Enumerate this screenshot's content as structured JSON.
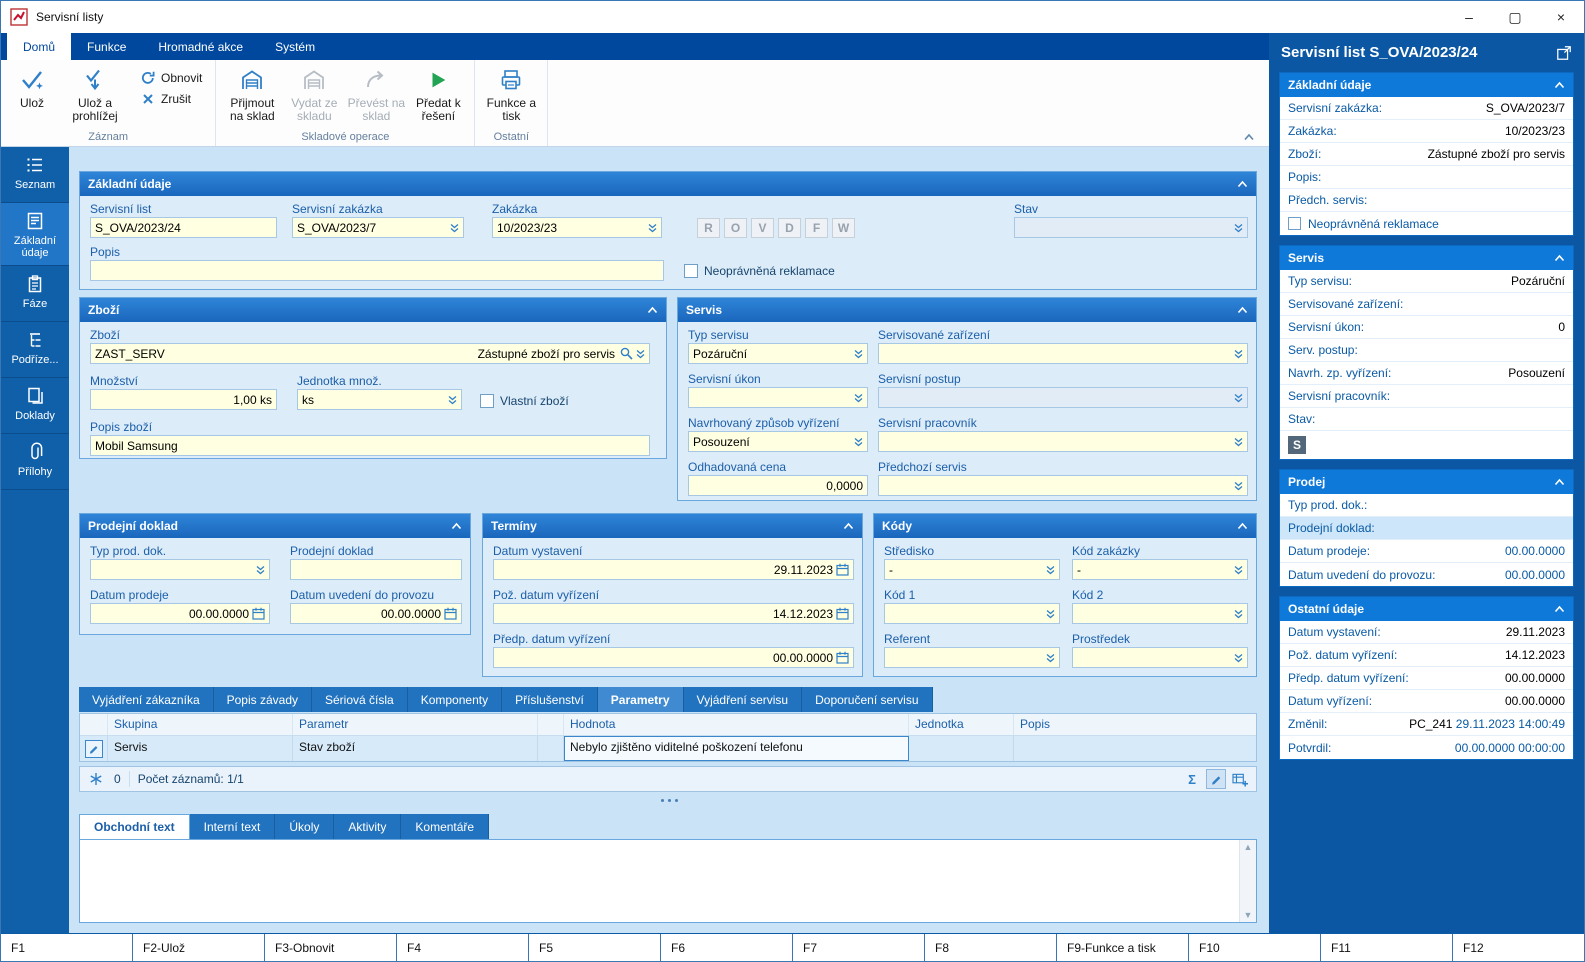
{
  "colors": {
    "accent": "#0a5aa5",
    "section_header": "#1d6fc4",
    "input_bg": "#ffffe1",
    "green": "#23a455",
    "panel_bg": "#0b57a4"
  },
  "icons": {
    "minimize": "–",
    "maximize": "▢",
    "close": "×",
    "sum": "Σ",
    "scroll_up": "▲",
    "scroll_down": "▼"
  },
  "titlebar": {
    "title": "Servisní listy",
    "minimize": "–",
    "maximize": "▢",
    "close": "×"
  },
  "ribbon": {
    "tabs": [
      {
        "label": "Domů",
        "active": true
      },
      {
        "label": "Funkce",
        "active": false
      },
      {
        "label": "Hromadné akce",
        "active": false
      },
      {
        "label": "Systém",
        "active": false
      }
    ],
    "buttons": {
      "save": "Ulož",
      "save_view": "Ulož a prohlížej",
      "refresh": "Obnovit",
      "cancel": "Zrušit",
      "receive": "Přijmout na sklad",
      "issue": "Vydat ze skladu",
      "transfer": "Převést na sklad",
      "pass": "Předat k řešení",
      "print": "Funkce a tisk"
    },
    "disabled": {
      "issue": true,
      "transfer": true
    },
    "groups": {
      "record": "Záznam",
      "stock": "Skladové operace",
      "other": "Ostatní"
    }
  },
  "sidebar": {
    "items": [
      {
        "label": "Seznam",
        "active": false
      },
      {
        "label": "Základní údaje",
        "active": true
      },
      {
        "label": "Fáze",
        "active": false
      },
      {
        "label": "Podříze...",
        "active": false
      },
      {
        "label": "Doklady",
        "active": false
      },
      {
        "label": "Přílohy",
        "active": false
      }
    ]
  },
  "main": {
    "basic": {
      "title": "Základní údaje",
      "servisni_list_label": "Servisní list",
      "servisni_list": "S_OVA/2023/24",
      "servisni_zakazka_label": "Servisní zakázka",
      "servisni_zakazka": "S_OVA/2023/7",
      "zakazka_label": "Zakázka",
      "zakazka": "10/2023/23",
      "flags": [
        "R",
        "O",
        "V",
        "D",
        "F",
        "W"
      ],
      "stav_label": "Stav",
      "stav": "",
      "popis_label": "Popis",
      "popis": "",
      "reklamace": "Neoprávněná reklamace"
    },
    "goods": {
      "title": "Zboží",
      "zbozi_label": "Zboží",
      "code": "ZAST_SERV",
      "name": "Zástupné zboží pro servis",
      "mnozstvi_label": "Množství",
      "mnozstvi": "1,00 ks",
      "jednotka_label": "Jednotka množ.",
      "jednotka": "ks",
      "vlastni": "Vlastní zboží",
      "popis_label": "Popis zboží",
      "popis": "Mobil Samsung"
    },
    "service": {
      "title": "Servis",
      "typ_label": "Typ servisu",
      "typ": "Pozáruční",
      "zarizeni_label": "Servisované zařízení",
      "zarizeni": "",
      "ukon_label": "Servisní úkon",
      "ukon": "",
      "postup_label": "Servisní postup",
      "postup": "",
      "zpusob_label": "Navrhovaný způsob vyřízení",
      "zpusob": "Posouzení",
      "pracovnik_label": "Servisní pracovník",
      "pracovnik": "",
      "cena_label": "Odhadovaná cena",
      "cena": "0,0000",
      "predchozi_label": "Předchozí servis",
      "predchozi": ""
    },
    "sale": {
      "title": "Prodejní doklad",
      "typ_label": "Typ prod. dok.",
      "typ": "",
      "doklad_label": "Prodejní doklad",
      "doklad": "",
      "datum_prodeje_label": "Datum prodeje",
      "datum_prodeje": "00.00.0000",
      "datum_uvedeni_label": "Datum uvedení do provozu",
      "datum_uvedeni": "00.00.0000"
    },
    "terms": {
      "title": "Termíny",
      "vystaveni_label": "Datum vystavení",
      "vystaveni": "29.11.2023",
      "poz_label": "Pož. datum vyřízení",
      "poz": "14.12.2023",
      "predp_label": "Předp. datum vyřízení",
      "predp": "00.00.0000"
    },
    "codes": {
      "title": "Kódy",
      "stredisko_label": "Středisko",
      "stredisko": "-",
      "kod_zakazky_label": "Kód zakázky",
      "kod_zakazky": "-",
      "kod1_label": "Kód 1",
      "kod1": "",
      "kod2_label": "Kód 2",
      "kod2": "",
      "referent_label": "Referent",
      "referent": "",
      "prostredek_label": "Prostředek",
      "prostredek": ""
    },
    "param_tabs": [
      {
        "label": "Vyjádření zákazníka",
        "active": false
      },
      {
        "label": "Popis závady",
        "active": false
      },
      {
        "label": "Sériová čísla",
        "active": false
      },
      {
        "label": "Komponenty",
        "active": false
      },
      {
        "label": "Příslušenství",
        "active": false
      },
      {
        "label": "Parametry",
        "active": true
      },
      {
        "label": "Vyjádření servisu",
        "active": false
      },
      {
        "label": "Doporučení servisu",
        "active": false
      }
    ],
    "param_table": {
      "headers": {
        "skupina": "Skupina",
        "parametr": "Parametr",
        "hodnota": "Hodnota",
        "jednotka": "Jednotka",
        "popis": "Popis"
      },
      "rows": [
        {
          "skupina": "Servis",
          "parametr": "Stav zboží",
          "hodnota": "Nebylo zjištěno viditelné poškození telefonu",
          "jednotka": "",
          "popis": ""
        }
      ],
      "counter": "0",
      "records": "Počet záznamů: 1/1"
    },
    "text_tabs": [
      {
        "label": "Obchodní text",
        "active": true
      },
      {
        "label": "Interní text",
        "active": false
      },
      {
        "label": "Úkoly",
        "active": false
      },
      {
        "label": "Aktivity",
        "active": false
      },
      {
        "label": "Komentáře",
        "active": false
      }
    ]
  },
  "right_panel": {
    "title": "Servisní list S_OVA/2023/24",
    "sections": [
      {
        "title": "Základní údaje",
        "rows": [
          {
            "label": "Servisní zakázka:",
            "value": "S_OVA/2023/7"
          },
          {
            "label": "Zakázka:",
            "value": "10/2023/23"
          },
          {
            "label": "Zboží:",
            "value": "Zástupné zboží pro servis"
          },
          {
            "label": "Popis:",
            "value": ""
          },
          {
            "label": "Předch. servis:",
            "value": ""
          },
          {
            "checkbox": true,
            "label": "Neoprávněná reklamace",
            "value": ""
          }
        ]
      },
      {
        "title": "Servis",
        "rows": [
          {
            "label": "Typ servisu:",
            "value": "Pozáruční"
          },
          {
            "label": "Servisované zařízení:",
            "value": ""
          },
          {
            "label": "Servisní úkon:",
            "value": "0"
          },
          {
            "label": "Serv. postup:",
            "value": ""
          },
          {
            "label": "Navrh. zp. vyřízení:",
            "value": "Posouzení"
          },
          {
            "label": "Servisní pracovník:",
            "value": ""
          },
          {
            "label": "Stav:",
            "value": ""
          },
          {
            "badge": "S",
            "label": "",
            "value": ""
          }
        ]
      },
      {
        "title": "Prodej",
        "rows": [
          {
            "label": "Typ prod. dok.:",
            "value": ""
          },
          {
            "label": "Prodejní doklad:",
            "value": "",
            "highlight": true
          },
          {
            "label": "Datum prodeje:",
            "value": "00.00.0000",
            "accent": true
          },
          {
            "label": "Datum uvedení do provozu:",
            "value": "00.00.0000",
            "accent": true
          }
        ]
      },
      {
        "title": "Ostatní údaje",
        "rows": [
          {
            "label": "Datum vystavení:",
            "value": "29.11.2023"
          },
          {
            "label": "Pož. datum vyřízení:",
            "value": "14.12.2023"
          },
          {
            "label": "Předp. datum vyřízení:",
            "value": "00.00.0000"
          },
          {
            "label": "Datum vyřízení:",
            "value": "00.00.0000"
          },
          {
            "label": "Změnil:",
            "prefix": "PC_241 ",
            "value": "29.11.2023 14:00:49",
            "accent": true
          },
          {
            "label": "Potvrdil:",
            "value": "00.00.0000 00:00:00",
            "accent": true
          }
        ]
      }
    ]
  },
  "fkeys": [
    "F1",
    "F2-Ulož",
    "F3-Obnovit",
    "F4",
    "F5",
    "F6",
    "F7",
    "F8",
    "F9-Funkce a tisk",
    "F10",
    "F11",
    "F12"
  ]
}
